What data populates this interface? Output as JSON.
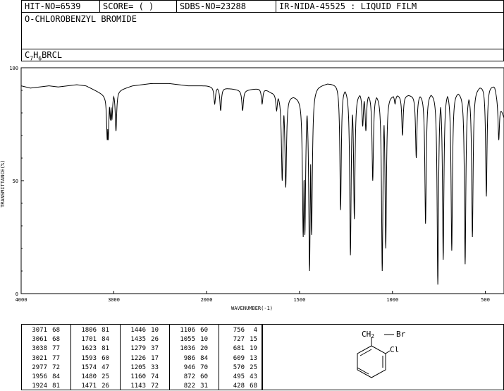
{
  "header": {
    "hit_no": "HIT-NO=6539",
    "score": "SCORE=  (  )",
    "sdbs_no": "SDBS-NO=23288",
    "ir_nida": "IR-NIDA-45525 : LIQUID FILM"
  },
  "compound": {
    "name": "O-CHLOROBENZYL BROMIDE",
    "formula_parts": [
      "C",
      "7",
      "H",
      "6",
      "BRCL"
    ]
  },
  "chart_data": {
    "type": "line",
    "xlabel": "WAVENUMBER(-1)",
    "ylabel": "TRANSMITTANCE(%)",
    "xlim": [
      4000,
      400
    ],
    "ylim": [
      0,
      100
    ],
    "x_ticks": [
      4000,
      3000,
      2000,
      1500,
      1000,
      500
    ],
    "y_ticks": [
      0,
      50,
      100
    ],
    "baseline": [
      [
        4000,
        92
      ],
      [
        3900,
        91
      ],
      [
        3800,
        91.5
      ],
      [
        3700,
        92
      ],
      [
        3600,
        91.5
      ],
      [
        3500,
        92
      ],
      [
        3400,
        92.5
      ],
      [
        3300,
        92
      ],
      [
        3250,
        91
      ],
      [
        3200,
        90
      ],
      [
        3150,
        89
      ],
      [
        3100,
        88
      ],
      [
        2800,
        92
      ],
      [
        2600,
        93
      ],
      [
        2400,
        93
      ],
      [
        2200,
        92
      ],
      [
        2000,
        92
      ],
      [
        1900,
        91
      ],
      [
        1800,
        90
      ],
      [
        1700,
        91
      ],
      [
        1650,
        89
      ],
      [
        1600,
        88
      ],
      [
        1500,
        87
      ],
      [
        1400,
        92
      ],
      [
        1350,
        93
      ],
      [
        1300,
        93
      ],
      [
        1250,
        91
      ],
      [
        1200,
        89
      ],
      [
        1000,
        88
      ],
      [
        900,
        88
      ],
      [
        800,
        89
      ],
      [
        700,
        90
      ],
      [
        600,
        89
      ],
      [
        500,
        93
      ],
      [
        450,
        92
      ],
      [
        400,
        78
      ]
    ],
    "peaks": [
      {
        "wn": 3071,
        "t": 68
      },
      {
        "wn": 3061,
        "t": 68
      },
      {
        "wn": 3038,
        "t": 77
      },
      {
        "wn": 3021,
        "t": 77
      },
      {
        "wn": 2977,
        "t": 72
      },
      {
        "wn": 1956,
        "t": 84
      },
      {
        "wn": 1924,
        "t": 81
      },
      {
        "wn": 1806,
        "t": 81
      },
      {
        "wn": 1701,
        "t": 84
      },
      {
        "wn": 1623,
        "t": 81
      },
      {
        "wn": 1593,
        "t": 50
      },
      {
        "wn": 1574,
        "t": 47
      },
      {
        "wn": 1480,
        "t": 25
      },
      {
        "wn": 1471,
        "t": 26
      },
      {
        "wn": 1446,
        "t": 10
      },
      {
        "wn": 1435,
        "t": 26
      },
      {
        "wn": 1279,
        "t": 37
      },
      {
        "wn": 1226,
        "t": 17
      },
      {
        "wn": 1205,
        "t": 33
      },
      {
        "wn": 1160,
        "t": 74
      },
      {
        "wn": 1143,
        "t": 72
      },
      {
        "wn": 1106,
        "t": 50
      },
      {
        "wn": 1055,
        "t": 10
      },
      {
        "wn": 1036,
        "t": 20
      },
      {
        "wn": 986,
        "t": 84
      },
      {
        "wn": 946,
        "t": 70
      },
      {
        "wn": 872,
        "t": 60
      },
      {
        "wn": 822,
        "t": 31
      },
      {
        "wn": 756,
        "t": 4
      },
      {
        "wn": 727,
        "t": 15
      },
      {
        "wn": 681,
        "t": 19
      },
      {
        "wn": 609,
        "t": 13
      },
      {
        "wn": 570,
        "t": 25
      },
      {
        "wn": 495,
        "t": 43
      },
      {
        "wn": 428,
        "t": 68
      }
    ]
  },
  "peak_columns": [
    [
      [
        "3071",
        "68"
      ],
      [
        "3061",
        "68"
      ],
      [
        "3038",
        "77"
      ],
      [
        "3021",
        "77"
      ],
      [
        "2977",
        "72"
      ],
      [
        "1956",
        "84"
      ],
      [
        "1924",
        "81"
      ]
    ],
    [
      [
        "1806",
        "81"
      ],
      [
        "1701",
        "84"
      ],
      [
        "1623",
        "81"
      ],
      [
        "1593",
        "60"
      ],
      [
        "1574",
        "47"
      ],
      [
        "1480",
        "25"
      ],
      [
        "1471",
        "26"
      ]
    ],
    [
      [
        "1446",
        "10"
      ],
      [
        "1435",
        "26"
      ],
      [
        "1279",
        "37"
      ],
      [
        "1226",
        "17"
      ],
      [
        "1205",
        "33"
      ],
      [
        "1160",
        "74"
      ],
      [
        "1143",
        "72"
      ]
    ],
    [
      [
        "1106",
        "60"
      ],
      [
        "1055",
        "10"
      ],
      [
        "1036",
        "20"
      ],
      [
        "986",
        "84"
      ],
      [
        "946",
        "70"
      ],
      [
        "872",
        "60"
      ],
      [
        "822",
        "31"
      ]
    ],
    [
      [
        "756",
        "4"
      ],
      [
        "727",
        "15"
      ],
      [
        "681",
        "19"
      ],
      [
        "609",
        "13"
      ],
      [
        "570",
        "25"
      ],
      [
        "495",
        "43"
      ],
      [
        "428",
        "68"
      ]
    ]
  ],
  "structure": {
    "label_ch2": "CH",
    "label_ch2_sub": "2",
    "label_br": "Br",
    "label_cl": "Cl"
  }
}
